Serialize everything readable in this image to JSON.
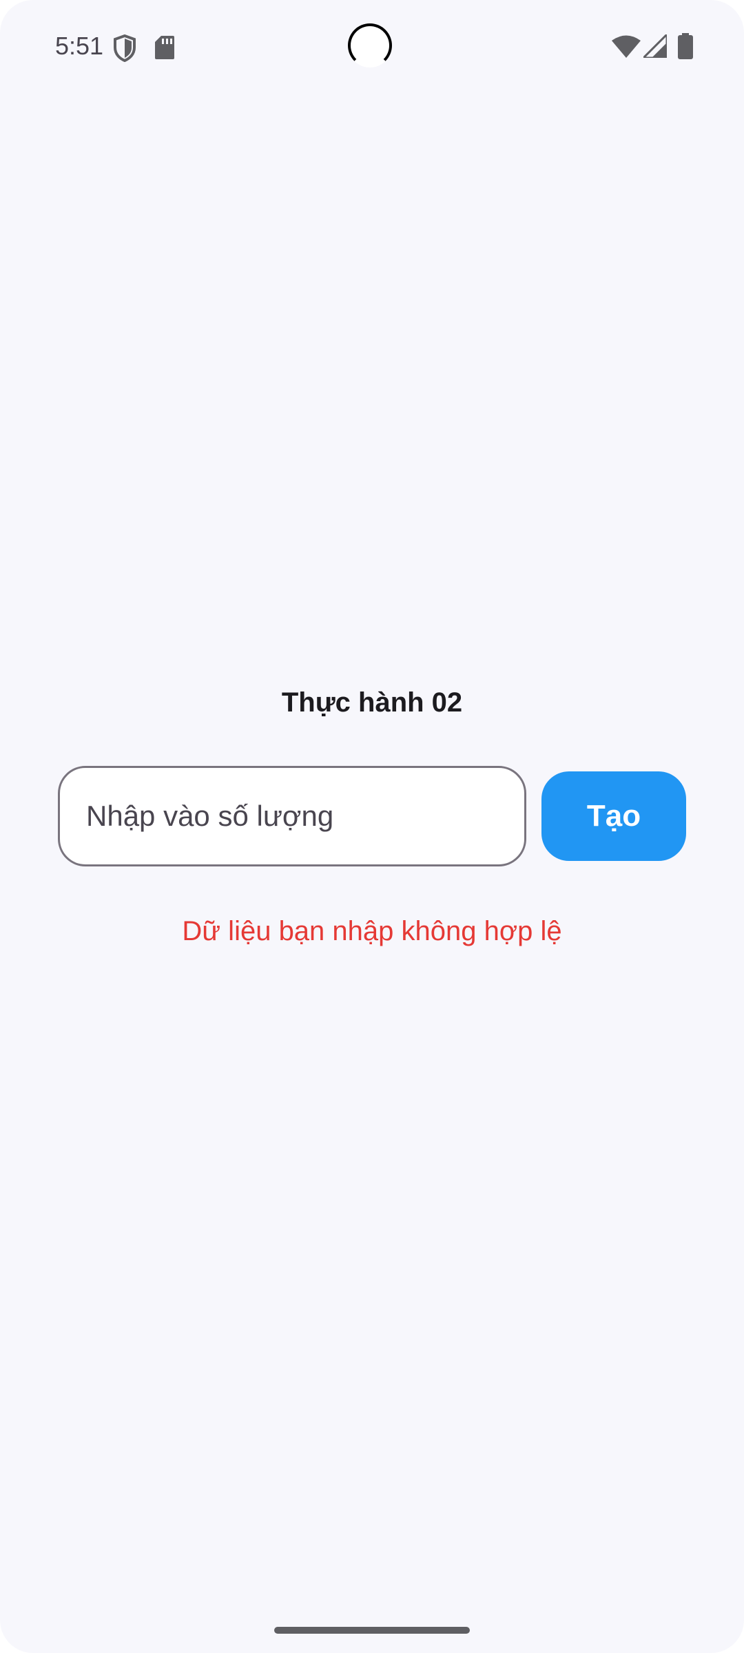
{
  "status_bar": {
    "time": "5:51",
    "icons": [
      "shield-icon",
      "sd-card-icon",
      "wifi-icon",
      "signal-icon",
      "battery-icon"
    ],
    "icon_color": "#5f5f63"
  },
  "main": {
    "title": "Thực hành 02",
    "input": {
      "placeholder": "Nhập vào số lượng",
      "value": ""
    },
    "button_label": "Tạo",
    "error_message": "Dữ liệu bạn nhập không hợp lệ"
  },
  "colors": {
    "background": "#f7f7fc",
    "accent": "#2196f3",
    "error": "#e53935",
    "input_border": "#79747e"
  }
}
